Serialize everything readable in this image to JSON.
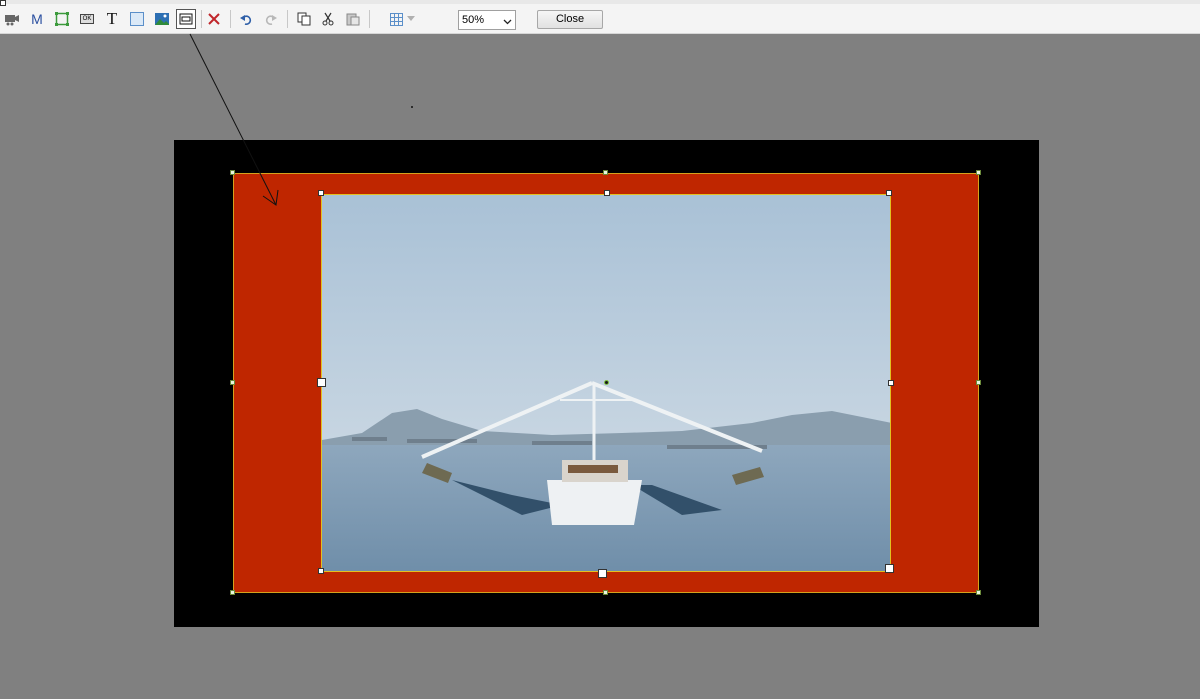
{
  "toolbar": {
    "tools": [
      {
        "id": "camera",
        "icon": "camera-icon"
      },
      {
        "id": "marker",
        "icon": "m-letter-icon",
        "glyph": "M"
      },
      {
        "id": "rectangle",
        "icon": "rectangle-select-icon"
      },
      {
        "id": "ok-button",
        "icon": "ok-button-icon",
        "glyph": "OK"
      },
      {
        "id": "text",
        "icon": "text-tool-icon",
        "glyph": "T"
      },
      {
        "id": "frame",
        "icon": "blank-frame-icon"
      },
      {
        "id": "image",
        "icon": "image-landscape-icon"
      },
      {
        "id": "box",
        "icon": "box-border-icon"
      },
      {
        "id": "delete",
        "icon": "delete-x-icon"
      },
      {
        "id": "undo",
        "icon": "undo-icon"
      },
      {
        "id": "redo",
        "icon": "redo-icon"
      },
      {
        "id": "copy",
        "icon": "copy-icon"
      },
      {
        "id": "cut",
        "icon": "cut-icon"
      },
      {
        "id": "paste",
        "icon": "paste-icon"
      },
      {
        "id": "grid",
        "icon": "grid-icon"
      }
    ],
    "zoom": {
      "value": "50%"
    },
    "close_label": "Close"
  },
  "colors": {
    "canvas_background": "#808080",
    "page_background": "#000000",
    "red_panel": "#bf2600",
    "selection_outline": "#e3c020"
  },
  "photo": {
    "subject": "shrimp trawler boat on sea with mountains and ships"
  }
}
